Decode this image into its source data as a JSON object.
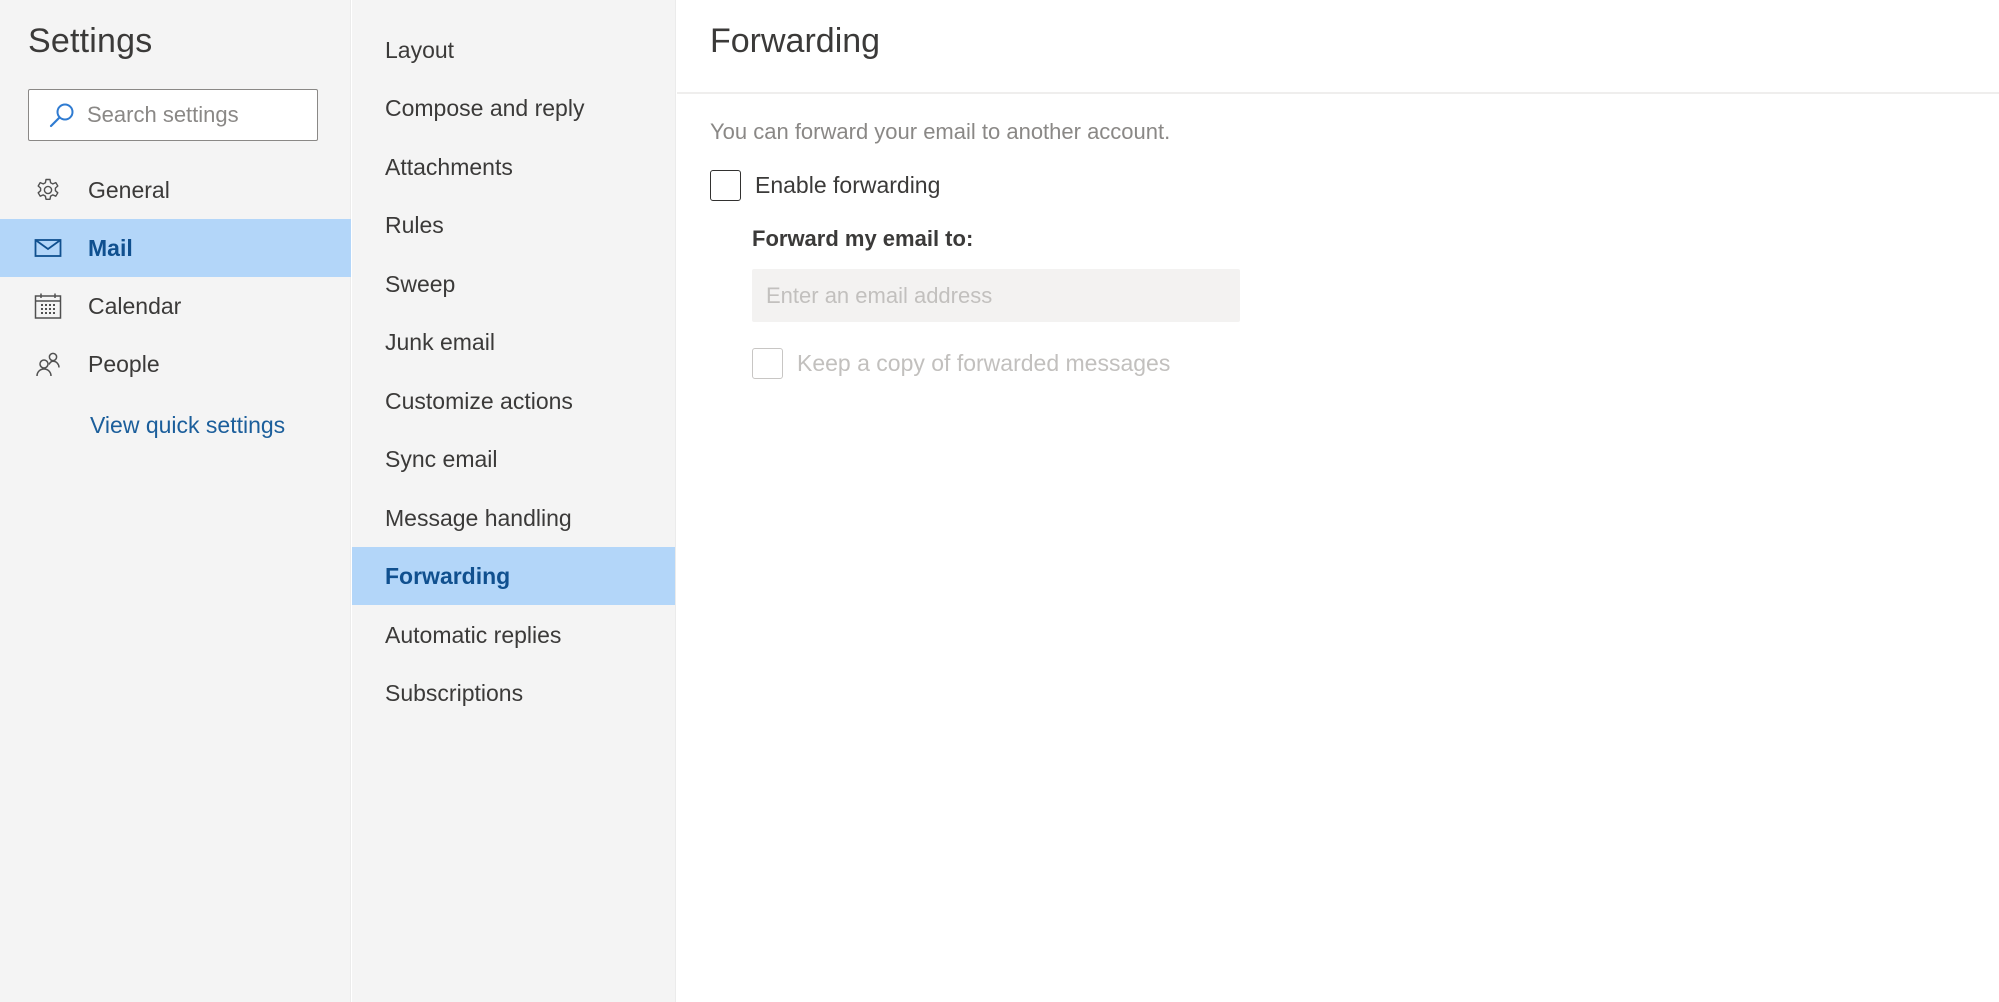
{
  "sidebar": {
    "title": "Settings",
    "search": {
      "placeholder": "Search settings",
      "value": ""
    },
    "items": [
      {
        "label": "General",
        "icon": "gear-icon",
        "active": false
      },
      {
        "label": "Mail",
        "icon": "mail-icon",
        "active": true
      },
      {
        "label": "Calendar",
        "icon": "calendar-icon",
        "active": false
      },
      {
        "label": "People",
        "icon": "people-icon",
        "active": false
      }
    ],
    "quick_settings_link": "View quick settings"
  },
  "subnav": {
    "items": [
      {
        "label": "Layout",
        "active": false
      },
      {
        "label": "Compose and reply",
        "active": false
      },
      {
        "label": "Attachments",
        "active": false
      },
      {
        "label": "Rules",
        "active": false
      },
      {
        "label": "Sweep",
        "active": false
      },
      {
        "label": "Junk email",
        "active": false
      },
      {
        "label": "Customize actions",
        "active": false
      },
      {
        "label": "Sync email",
        "active": false
      },
      {
        "label": "Message handling",
        "active": false
      },
      {
        "label": "Forwarding",
        "active": true
      },
      {
        "label": "Automatic replies",
        "active": false
      },
      {
        "label": "Subscriptions",
        "active": false
      }
    ]
  },
  "main": {
    "title": "Forwarding",
    "description": "You can forward your email to another account.",
    "enable_forwarding": {
      "label": "Enable forwarding",
      "checked": false
    },
    "forward_to": {
      "label": "Forward my email to:",
      "placeholder": "Enter an email address",
      "value": "",
      "disabled": true
    },
    "keep_copy": {
      "label": "Keep a copy of forwarded messages",
      "checked": false,
      "disabled": true
    }
  },
  "colors": {
    "selected_bg": "#b3d6f9",
    "selected_text": "#10508f",
    "link": "#1b5e9b",
    "panel_bg": "#f4f4f4"
  }
}
